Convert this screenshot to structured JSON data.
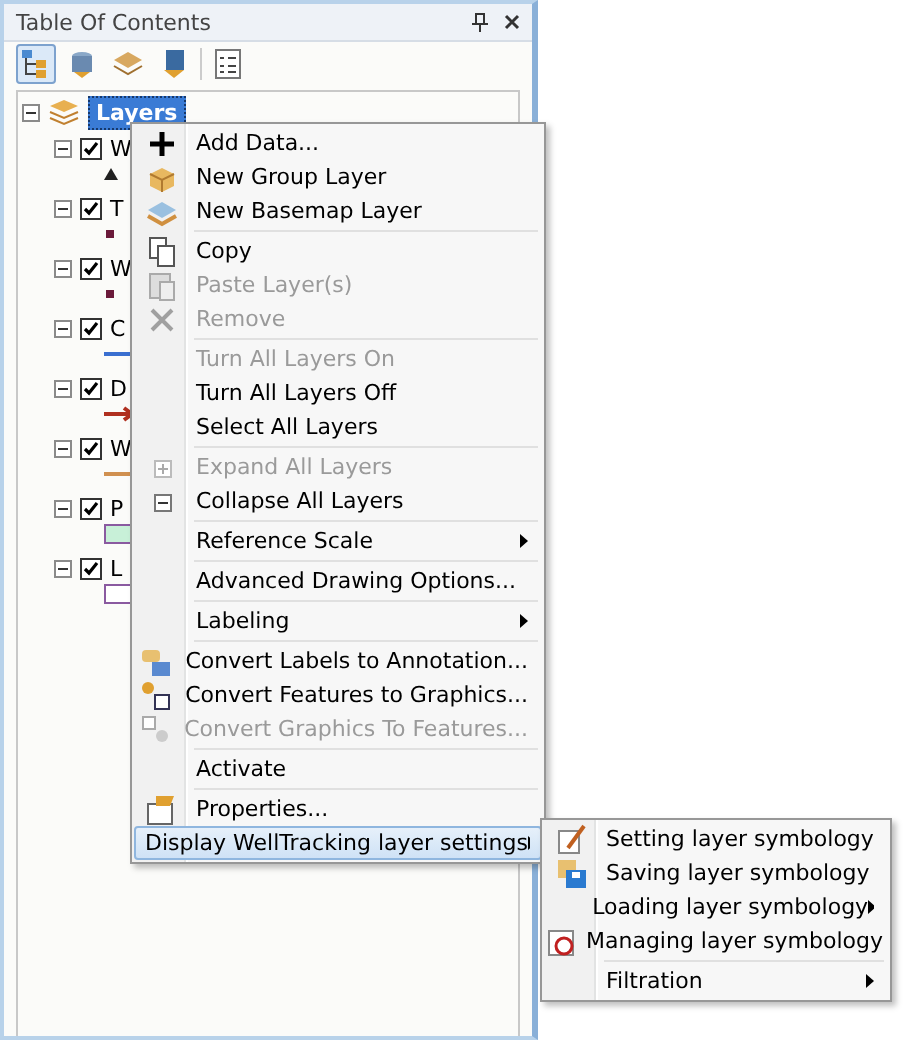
{
  "panel": {
    "title": "Table Of Contents"
  },
  "toolbar": [
    {
      "kind": "tree",
      "selected": true
    },
    {
      "kind": "source",
      "selected": false
    },
    {
      "kind": "visibility",
      "selected": false
    },
    {
      "kind": "selection",
      "selected": false
    },
    {
      "kind": "options",
      "selected": false
    }
  ],
  "tree": {
    "label": "Layers",
    "expanded": true,
    "selected": true,
    "children": [
      {
        "label": "W",
        "checked": true,
        "expanded": true,
        "symbol": {
          "kind": "triangle",
          "color": "#202020"
        }
      },
      {
        "label": "T",
        "checked": true,
        "expanded": true,
        "symbol": {
          "kind": "dot",
          "color": "#6b1a3a"
        }
      },
      {
        "label": "W",
        "checked": true,
        "expanded": true,
        "symbol": {
          "kind": "dot",
          "color": "#6b1a3a"
        }
      },
      {
        "label": "C",
        "checked": true,
        "expanded": true,
        "symbol": {
          "kind": "line",
          "color": "#3a6fd0"
        }
      },
      {
        "label": "D",
        "checked": true,
        "expanded": true,
        "symbol": {
          "kind": "arrow",
          "color": "#b03020"
        }
      },
      {
        "label": "W",
        "checked": true,
        "expanded": true,
        "symbol": {
          "kind": "line",
          "color": "#d09050"
        }
      },
      {
        "label": "P",
        "checked": true,
        "expanded": true,
        "symbol": {
          "kind": "rect",
          "color": "#c8f0d8"
        }
      },
      {
        "label": "L",
        "checked": true,
        "expanded": true,
        "symbol": {
          "kind": "rect",
          "color": "#ffffff"
        }
      }
    ]
  },
  "context_menu": [
    {
      "kind": "item",
      "label": "Add Data...",
      "disabled": false,
      "submenu": false,
      "selected": false
    },
    {
      "kind": "item",
      "label": "New Group Layer",
      "disabled": false,
      "submenu": false,
      "selected": false
    },
    {
      "kind": "item",
      "label": "New Basemap Layer",
      "disabled": false,
      "submenu": false,
      "selected": false
    },
    {
      "kind": "separator"
    },
    {
      "kind": "item",
      "label": "Copy",
      "disabled": false,
      "submenu": false,
      "selected": false
    },
    {
      "kind": "item",
      "label": "Paste Layer(s)",
      "disabled": true,
      "submenu": false,
      "selected": false
    },
    {
      "kind": "item",
      "label": "Remove",
      "disabled": true,
      "submenu": false,
      "selected": false
    },
    {
      "kind": "separator"
    },
    {
      "kind": "item",
      "label": "Turn All Layers On",
      "disabled": true,
      "submenu": false,
      "selected": false
    },
    {
      "kind": "item",
      "label": "Turn All Layers Off",
      "disabled": false,
      "submenu": false,
      "selected": false
    },
    {
      "kind": "item",
      "label": "Select All Layers",
      "disabled": false,
      "submenu": false,
      "selected": false
    },
    {
      "kind": "separator"
    },
    {
      "kind": "item",
      "label": "Expand All Layers",
      "disabled": true,
      "submenu": false,
      "selected": false
    },
    {
      "kind": "item",
      "label": "Collapse All Layers",
      "disabled": false,
      "submenu": false,
      "selected": false
    },
    {
      "kind": "separator"
    },
    {
      "kind": "item",
      "label": "Reference Scale",
      "disabled": false,
      "submenu": true,
      "selected": false
    },
    {
      "kind": "separator"
    },
    {
      "kind": "item",
      "label": "Advanced Drawing Options...",
      "disabled": false,
      "submenu": false,
      "selected": false
    },
    {
      "kind": "separator"
    },
    {
      "kind": "item",
      "label": "Labeling",
      "disabled": false,
      "submenu": true,
      "selected": false
    },
    {
      "kind": "separator"
    },
    {
      "kind": "item",
      "label": "Convert Labels to Annotation...",
      "disabled": false,
      "submenu": false,
      "selected": false
    },
    {
      "kind": "item",
      "label": "Convert Features to Graphics...",
      "disabled": false,
      "submenu": false,
      "selected": false
    },
    {
      "kind": "item",
      "label": "Convert Graphics To Features...",
      "disabled": true,
      "submenu": false,
      "selected": false
    },
    {
      "kind": "separator"
    },
    {
      "kind": "item",
      "label": "Activate",
      "disabled": false,
      "submenu": false,
      "selected": false
    },
    {
      "kind": "separator"
    },
    {
      "kind": "item",
      "label": "Properties...",
      "disabled": false,
      "submenu": false,
      "selected": false
    },
    {
      "kind": "item",
      "label": "Display WellTracking layer settings",
      "disabled": false,
      "submenu": true,
      "selected": true
    }
  ],
  "submenu": [
    {
      "kind": "item",
      "label": "Setting layer symbology",
      "submenu": false
    },
    {
      "kind": "item",
      "label": "Saving layer symbology",
      "submenu": false
    },
    {
      "kind": "item",
      "label": "Loading layer symbology",
      "submenu": true
    },
    {
      "kind": "item",
      "label": "Managing layer symbology",
      "submenu": false
    },
    {
      "kind": "separator"
    },
    {
      "kind": "item",
      "label": "Filtration",
      "submenu": true
    }
  ]
}
